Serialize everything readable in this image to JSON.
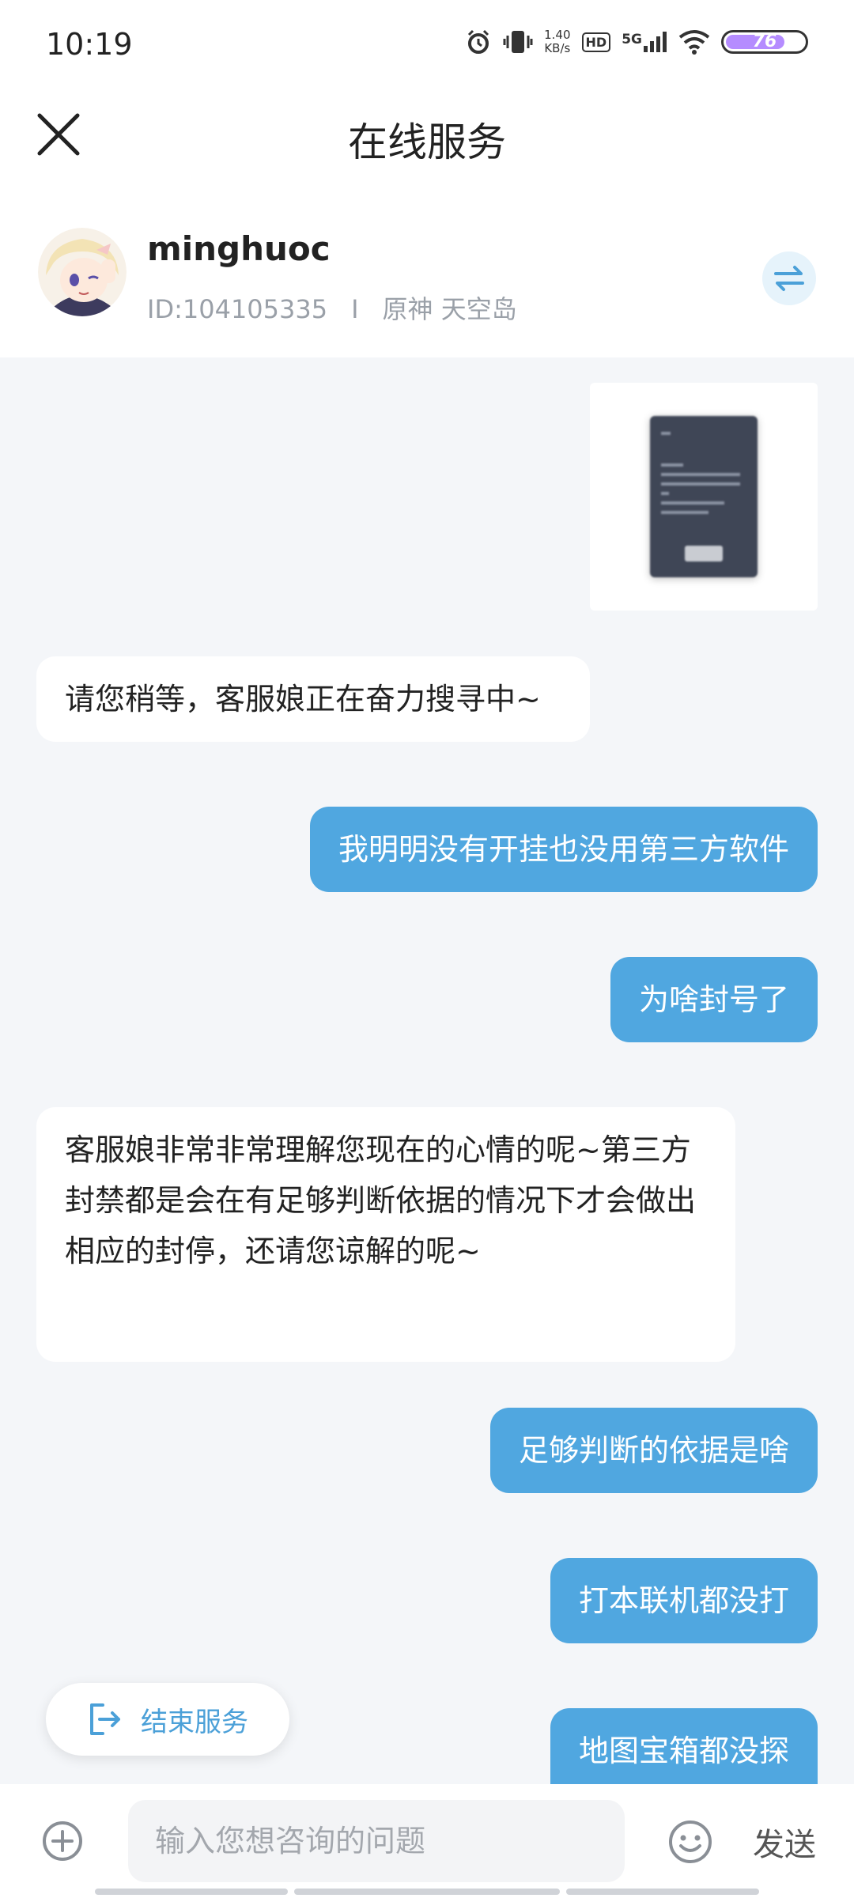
{
  "status_bar": {
    "time": "10:19",
    "net_speed_value": "1.40",
    "net_speed_unit": "KB/s",
    "hd": "HD",
    "signal": "5G",
    "battery": "76",
    "battery_level": 0.76
  },
  "header": {
    "title": "在线服务"
  },
  "user": {
    "name": "minghuoc",
    "id": "ID:104105335",
    "separator": "I",
    "server": "原神 天空岛"
  },
  "messages": [
    {
      "side": "left",
      "text": "请您稍等，客服娘正在奋力搜寻中~"
    },
    {
      "side": "right",
      "text": "我明明没有开挂也没用第三方软件"
    },
    {
      "side": "right",
      "text": "为啥封号了"
    },
    {
      "side": "left",
      "text": "客服娘非常非常理解您现在的心情的呢~第三方封禁都是会在有足够判断依据的情况下才会做出相应的封停，还请您谅解的呢~"
    },
    {
      "side": "right",
      "text": "足够判断的依据是啥"
    },
    {
      "side": "right",
      "text": "打本联机都没打"
    },
    {
      "side": "right",
      "text": "地图宝箱都没探"
    }
  ],
  "end_service": {
    "label": "结束服务"
  },
  "input_bar": {
    "placeholder": "输入您想咨询的问题",
    "send_label": "发送"
  },
  "colors": {
    "accent": "#50a7e0",
    "background": "#f4f6f9"
  }
}
